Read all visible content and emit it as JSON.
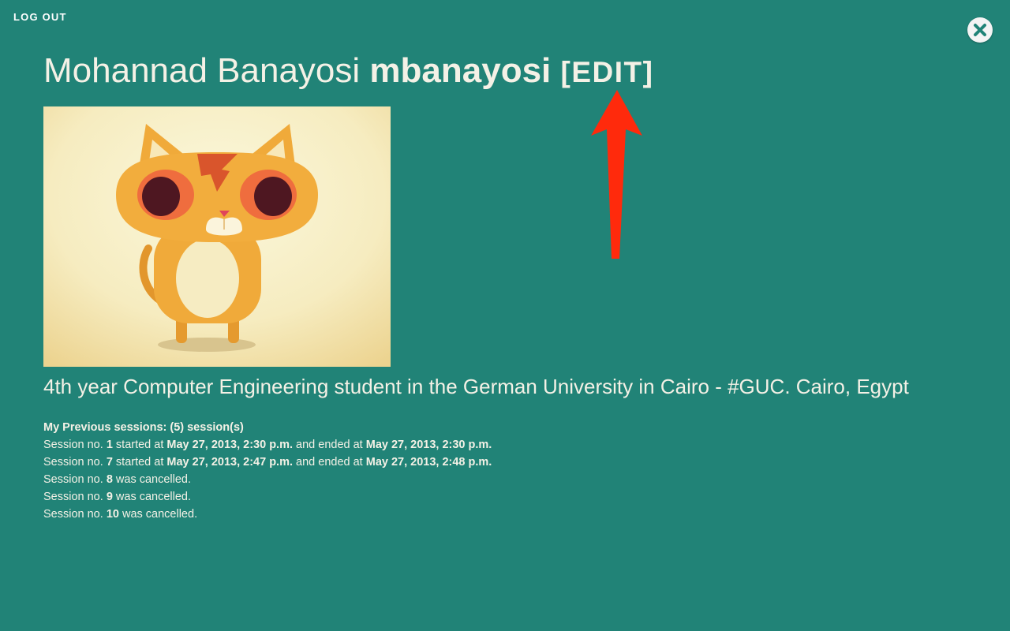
{
  "nav": {
    "logout_label": "LOG OUT",
    "close_icon": "close-icon"
  },
  "profile": {
    "full_name": "Mohannad Banayosi",
    "username": "mbanayosi",
    "edit_label": "[EDIT]",
    "bio": "4th year Computer Engineering student in the German University in Cairo - #GUC. Cairo, Egypt",
    "avatar_icon": "cat-avatar"
  },
  "sessions": {
    "title": "My Previous sessions: (5) session(s)",
    "prefix": "Session no.",
    "started_text": "started at",
    "ended_text": "and ended at",
    "cancelled_text": "was cancelled.",
    "items": [
      {
        "no": "1",
        "started": "May 27, 2013, 2:30 p.m.",
        "ended": "May 27, 2013, 2:30 p.m."
      },
      {
        "no": "7",
        "started": "May 27, 2013, 2:47 p.m.",
        "ended": "May 27, 2013, 2:48 p.m."
      },
      {
        "no": "8"
      },
      {
        "no": "9"
      },
      {
        "no": "10"
      }
    ]
  },
  "colors": {
    "background": "#218377",
    "text": "#f4f1e6",
    "annotation_arrow": "#ff2a0c"
  },
  "annotation": {
    "icon": "red-arrow-icon"
  }
}
